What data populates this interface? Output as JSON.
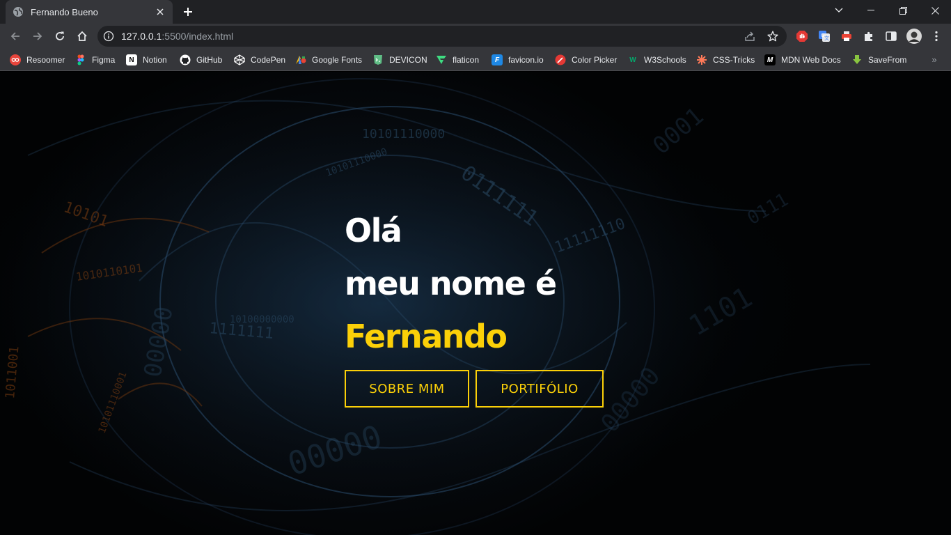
{
  "browser": {
    "tab": {
      "title": "Fernando Bueno"
    },
    "address": {
      "host": "127.0.0.1",
      "path": ":5500/index.html"
    }
  },
  "bookmarks": [
    {
      "label": "Resoomer",
      "icon": "resoomer-icon",
      "color": "#e8453c"
    },
    {
      "label": "Figma",
      "icon": "figma-icon",
      "color": "#f24e1e"
    },
    {
      "label": "Notion",
      "icon": "notion-icon",
      "color": "#ffffff"
    },
    {
      "label": "GitHub",
      "icon": "github-icon",
      "color": "#ffffff"
    },
    {
      "label": "CodePen",
      "icon": "codepen-icon",
      "color": "#ffffff"
    },
    {
      "label": "Google Fonts",
      "icon": "google-fonts-icon",
      "color": "#fbbc04"
    },
    {
      "label": "DEVICON",
      "icon": "devicon-icon",
      "color": "#60be86"
    },
    {
      "label": "flaticon",
      "icon": "flaticon-icon",
      "color": "#3edc81"
    },
    {
      "label": "favicon.io",
      "icon": "favicon-io-icon",
      "color": "#1e88e5"
    },
    {
      "label": "Color Picker",
      "icon": "color-picker-icon",
      "color": "#e53935"
    },
    {
      "label": "W3Schools",
      "icon": "w3schools-icon",
      "color": "#04aa6d"
    },
    {
      "label": "CSS-Tricks",
      "icon": "css-tricks-icon",
      "color": "#ff7a59"
    },
    {
      "label": "MDN Web Docs",
      "icon": "mdn-icon",
      "color": "#ffffff"
    },
    {
      "label": "SaveFrom",
      "icon": "savefrom-icon",
      "color": "#89c540"
    }
  ],
  "hero": {
    "line1": "Olá",
    "line2": "meu nome é",
    "name": "Fernando",
    "buttons": {
      "about": "SOBRE MIM",
      "portfolio": "PORTIFÓLIO"
    }
  },
  "colors": {
    "accent": "#fbd008",
    "text": "#ffffff",
    "background": "#000000"
  }
}
